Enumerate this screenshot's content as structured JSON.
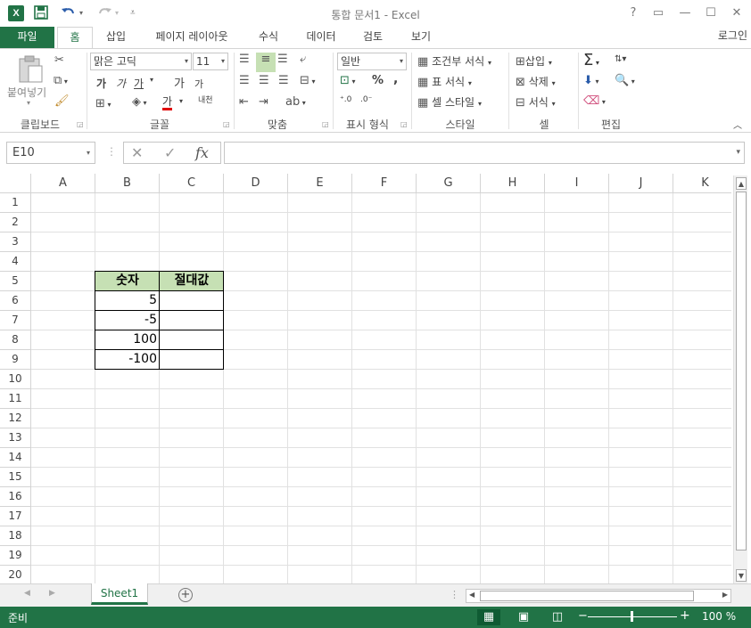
{
  "app": {
    "title": "통합 문서1 - Excel",
    "logo_letter": "X",
    "signin": "로그인"
  },
  "quick_access": {
    "save_icon": "save-icon",
    "undo_icon": "undo-icon",
    "redo_icon": "redo-icon"
  },
  "window_buttons": [
    "?",
    "▭",
    "—",
    "☐",
    "✕"
  ],
  "tabs": [
    "파일",
    "홈",
    "삽입",
    "페이지 레이아웃",
    "수식",
    "데이터",
    "검토",
    "보기"
  ],
  "ribbon": {
    "clipboard": {
      "label": "클립보드",
      "paste": "붙여넣기"
    },
    "font": {
      "label": "글꼴",
      "name": "맑은 고딕",
      "size": "11",
      "bold": "가",
      "italic": "가",
      "underline": "가",
      "grow": "가",
      "shrink": "가",
      "color": "가",
      "phonetic": "내천"
    },
    "align": {
      "label": "맞춤"
    },
    "number": {
      "label": "표시 형식",
      "format": "일반",
      "percent": "%",
      "comma": ","
    },
    "styles": {
      "label": "스타일",
      "conditional": "조건부 서식",
      "table": "표 서식",
      "cell_styles": "셀 스타일"
    },
    "cells": {
      "label": "셀",
      "insert": "삽입",
      "delete": "삭제",
      "format": "서식"
    },
    "editing": {
      "label": "편집"
    }
  },
  "formula_bar": {
    "name_box": "E10",
    "formula": ""
  },
  "columns": [
    "A",
    "B",
    "C",
    "D",
    "E",
    "F",
    "G",
    "H",
    "I",
    "J",
    "K"
  ],
  "rows": [
    "1",
    "2",
    "3",
    "4",
    "5",
    "6",
    "7",
    "8",
    "9",
    "10",
    "11",
    "12",
    "13",
    "14",
    "15",
    "16",
    "17",
    "18",
    "19",
    "20"
  ],
  "table": {
    "header": [
      "숫자",
      "절대값"
    ],
    "values": [
      "5",
      "-5",
      "100",
      "-100"
    ]
  },
  "sheets": [
    "Sheet1"
  ],
  "status": {
    "ready": "준비",
    "zoom": "100 %"
  },
  "colors": {
    "accent": "#217346",
    "header_fill": "#c6e0b4"
  }
}
